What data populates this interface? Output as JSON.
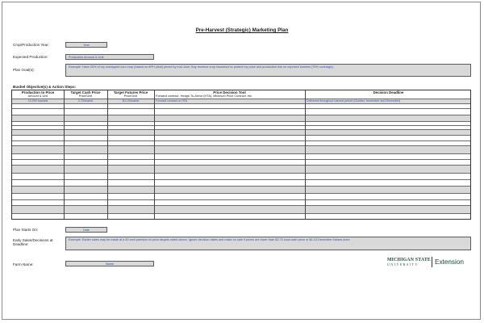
{
  "title": "Pre-Harvest (Strategic) Marketing Plan",
  "crop_year": {
    "label": "Crop/Production Year:",
    "value": "Year"
  },
  "expected_production": {
    "label": "Expected Production:",
    "value": "Production Amount & Unit"
  },
  "plan_goals": {
    "label": "Plan Goal(s):",
    "value": "Example: Have 25% of my unshipped corn crop (based on APH yield) priced by mid-June. Buy revenue crop insurance to protect my price and production risk on unpriced bushels (75% coverage)."
  },
  "action_steps": {
    "label": "Bushel Objective(s) & Action Steps:",
    "columns": [
      {
        "header": "Production to Price",
        "sub": "Amount & Unit",
        "example": "10,000 bushels"
      },
      {
        "header": "Target Cash Price",
        "sub": "Price/Unit",
        "example": "3.75/bushel"
      },
      {
        "header": "Target Futures Price",
        "sub": "Price/Unit",
        "example": "$4.15/bushel"
      },
      {
        "header": "Price Decision Tool",
        "sub": "Forward contract, Hedge-To-Arrive (HTA), Minimum Price Contract, etc.",
        "example": "Forward contract or HTA"
      },
      {
        "header": "Decision Deadline",
        "sub": "",
        "example": "Delivered throughout harvest period (October, November and December)"
      }
    ]
  },
  "plan_starts": {
    "label": "Plan Starts On:",
    "value": "Date"
  },
  "early_sales": {
    "label": "Early Sales/Decisions at Deadline:",
    "value": "Example: Earlier sales may be made at a 40 cent premium to price targets noted above. Ignore decision dates and make no sale if prices are lower than $3.75 local cash price or $4.15 December futures price."
  },
  "farm_name": {
    "label": "Farm Name:",
    "value": "Name"
  },
  "logo": {
    "top": "MICHIGAN STATE",
    "bottom": "UNIVERSITY",
    "extension": "Extension"
  },
  "colors": {
    "field_fill": "#d9d9d9",
    "field_text": "#2f4fae",
    "logo_green": "#18453b"
  }
}
